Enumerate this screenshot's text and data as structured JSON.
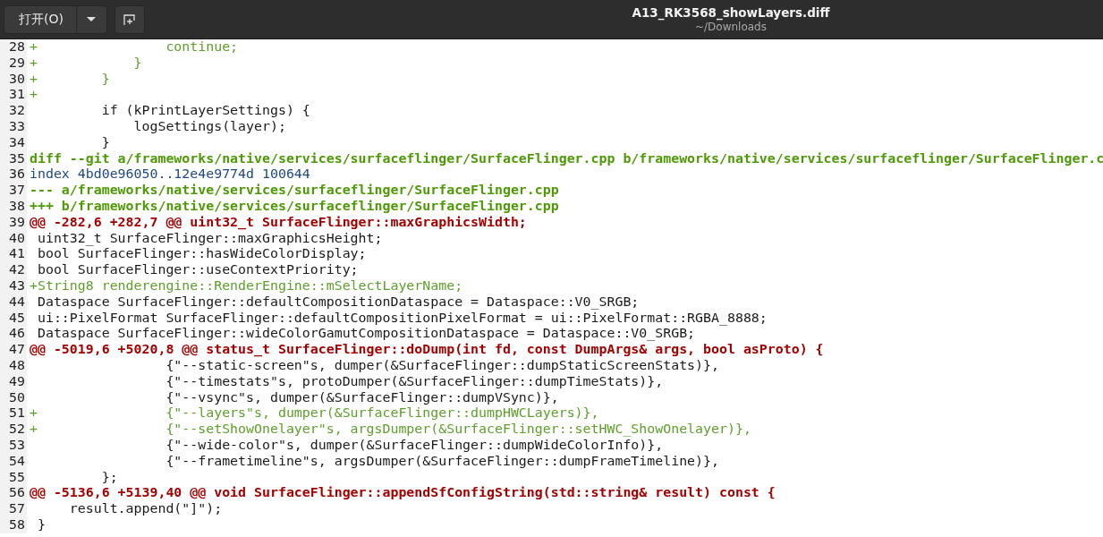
{
  "header": {
    "open_button": "打开(O)",
    "title": "A13_RK3568_showLayers.diff",
    "subtitle": "~/Downloads"
  },
  "lines": [
    {
      "number": "28",
      "kind": "added",
      "text": "+                continue;"
    },
    {
      "number": "29",
      "kind": "added",
      "text": "+            }"
    },
    {
      "number": "30",
      "kind": "added",
      "text": "+        }"
    },
    {
      "number": "31",
      "kind": "added",
      "text": "+"
    },
    {
      "number": "32",
      "kind": "context",
      "text": "         if (kPrintLayerSettings) {"
    },
    {
      "number": "33",
      "kind": "context",
      "text": "             logSettings(layer);"
    },
    {
      "number": "34",
      "kind": "context",
      "text": "         }"
    },
    {
      "number": "35",
      "kind": "file_header",
      "text": "diff --git a/frameworks/native/services/surfaceflinger/SurfaceFlinger.cpp b/frameworks/native/services/surfaceflinger/SurfaceFlinger.c"
    },
    {
      "number": "36",
      "kind": "index",
      "text": "index 4bd0e96050..12e4e9774d 100644"
    },
    {
      "number": "37",
      "kind": "file_header",
      "text": "--- a/frameworks/native/services/surfaceflinger/SurfaceFlinger.cpp"
    },
    {
      "number": "38",
      "kind": "file_header",
      "text": "+++ b/frameworks/native/services/surfaceflinger/SurfaceFlinger.cpp"
    },
    {
      "number": "39",
      "kind": "hunk",
      "text": "@@ -282,6 +282,7 @@ uint32_t SurfaceFlinger::maxGraphicsWidth;"
    },
    {
      "number": "40",
      "kind": "context",
      "text": " uint32_t SurfaceFlinger::maxGraphicsHeight;"
    },
    {
      "number": "41",
      "kind": "context",
      "text": " bool SurfaceFlinger::hasWideColorDisplay;"
    },
    {
      "number": "42",
      "kind": "context",
      "text": " bool SurfaceFlinger::useContextPriority;"
    },
    {
      "number": "43",
      "kind": "added",
      "text": "+String8 renderengine::RenderEngine::mSelectLayerName;"
    },
    {
      "number": "44",
      "kind": "context",
      "text": " Dataspace SurfaceFlinger::defaultCompositionDataspace = Dataspace::V0_SRGB;"
    },
    {
      "number": "45",
      "kind": "context",
      "text": " ui::PixelFormat SurfaceFlinger::defaultCompositionPixelFormat = ui::PixelFormat::RGBA_8888;"
    },
    {
      "number": "46",
      "kind": "context",
      "text": " Dataspace SurfaceFlinger::wideColorGamutCompositionDataspace = Dataspace::V0_SRGB;"
    },
    {
      "number": "47",
      "kind": "hunk",
      "text": "@@ -5019,6 +5020,8 @@ status_t SurfaceFlinger::doDump(int fd, const DumpArgs& args, bool asProto) {"
    },
    {
      "number": "48",
      "kind": "context",
      "text": "                 {\"--static-screen\"s, dumper(&SurfaceFlinger::dumpStaticScreenStats)},"
    },
    {
      "number": "49",
      "kind": "context",
      "text": "                 {\"--timestats\"s, protoDumper(&SurfaceFlinger::dumpTimeStats)},"
    },
    {
      "number": "50",
      "kind": "context",
      "text": "                 {\"--vsync\"s, dumper(&SurfaceFlinger::dumpVSync)},"
    },
    {
      "number": "51",
      "kind": "added",
      "text": "+                {\"--layers\"s, dumper(&SurfaceFlinger::dumpHWCLayers)},"
    },
    {
      "number": "52",
      "kind": "added",
      "text": "+                {\"--setShowOnelayer\"s, argsDumper(&SurfaceFlinger::setHWC_ShowOnelayer)},"
    },
    {
      "number": "53",
      "kind": "context",
      "text": "                 {\"--wide-color\"s, dumper(&SurfaceFlinger::dumpWideColorInfo)},"
    },
    {
      "number": "54",
      "kind": "context",
      "text": "                 {\"--frametimeline\"s, argsDumper(&SurfaceFlinger::dumpFrameTimeline)},"
    },
    {
      "number": "55",
      "kind": "context",
      "text": "         };"
    },
    {
      "number": "56",
      "kind": "hunk",
      "text": "@@ -5136,6 +5139,40 @@ void SurfaceFlinger::appendSfConfigString(std::string& result) const {"
    },
    {
      "number": "57",
      "kind": "context",
      "text": "     result.append(\"]\");"
    },
    {
      "number": "58",
      "kind": "context",
      "text": " }"
    }
  ]
}
